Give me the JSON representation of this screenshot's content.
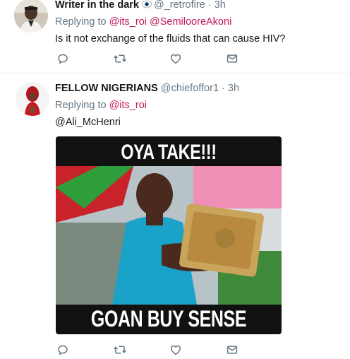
{
  "tweets": [
    {
      "name": "Writer in the dark",
      "handle": "@_retrofire",
      "separator": "·",
      "time": "3h",
      "replying_prefix": "Replying to",
      "replying_to": [
        "@its_roi",
        "@SemilooreAkoni"
      ],
      "text": "Is it not exchange of the fluids that can cause HIV?",
      "badge_icon": "eye-emoji-icon"
    },
    {
      "name": "FELLOW NIGERIANS",
      "handle": "@chiefoffor1",
      "separator": "·",
      "time": "3h",
      "replying_prefix": "Replying to",
      "replying_to": [
        "@its_roi"
      ],
      "text": "@Ali_McHenri",
      "media": {
        "top_caption": "OYA TAKE!!!",
        "bottom_caption": "GOAN BUY SENSE"
      }
    }
  ],
  "actions": [
    "reply-icon",
    "retweet-icon",
    "like-icon",
    "message-icon"
  ],
  "colors": {
    "mention": "#c2185b",
    "muted": "#657786",
    "divider": "#e6ecf0"
  }
}
